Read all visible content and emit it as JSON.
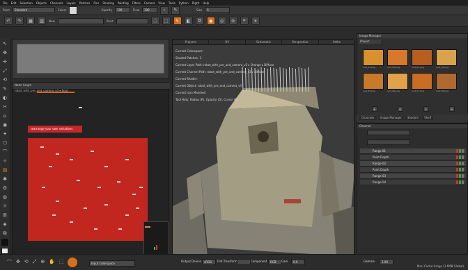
{
  "menu": [
    "File",
    "Edit",
    "Selection",
    "Objects",
    "Channels",
    "Layers",
    "Patches",
    "Pins",
    "Shading",
    "Painting",
    "Filters",
    "Camera",
    "View",
    "Tools",
    "Python",
    "Right",
    "Help"
  ],
  "toolbar1": {
    "paint_label": "Paint",
    "paint_mode": "Standard",
    "colors_label": "Colors",
    "opacity_label": "Opacity",
    "opacity_value": "100",
    "flow_label": "Flow",
    "flow_value": "100",
    "size_label": "Size",
    "size_value": "5"
  },
  "toolbar2": {
    "new_label": "New",
    "paint_label": "Paint"
  },
  "left_tools": [
    "↖",
    "✥",
    "✛",
    "⤢",
    "⟲",
    "✎",
    "◐",
    "✂",
    "⌂",
    "◉",
    "✦",
    "⬡",
    "⌒",
    "✧",
    "▤",
    "✱",
    "⚙",
    "◍",
    "☼",
    "⊞",
    "◈",
    "⧉"
  ],
  "node_graph": {
    "tab_label": "Node Graph",
    "path": "robot_with_pre_and_camera_v3 ▾ Root",
    "button_label": "rearrange your own variations"
  },
  "viewport": {
    "tabs": [
      "Projects",
      "UV",
      "Schematic",
      "Perspective",
      "Ortho"
    ],
    "info": [
      "Current Colorspace:",
      "Shaded Patches: 1",
      "Current Layer Path: robot_with_pre_and_camera_v3 ▸ Orange ▸ Diffuse",
      "Current Channel Path: robot_with_pre_and_camera_v3 ▸ Diffuse",
      "Current Shader:",
      "Current Object: robot_with_pre_and_camera_v3",
      "Current Icon Manifest:",
      "Tool Help: Radius (R), Opacity (O), Cursor (S)"
    ]
  },
  "image_manager": {
    "title": "Image Manager",
    "tab": "Project",
    "thumbs": [
      "rust_01.png",
      "rust_02.png",
      "rust_03.png",
      "rust_04.png",
      "rust_05.png",
      "rust_06.png",
      "rust_07.png",
      "rust_08.png"
    ],
    "colors": [
      "#d9912f",
      "#d6792a",
      "#b85e21",
      "#d9a24c",
      "#c97a28",
      "#e0a24a",
      "#c96d25",
      "#b06a30"
    ]
  },
  "shelf_tabs": [
    "Channels",
    "Image Manager",
    "Shaders",
    "Shelf"
  ],
  "layers": {
    "header": "Channel",
    "rows": [
      {
        "label": "Range 01",
        "sub": false
      },
      {
        "label": "Paint Depth",
        "sub": true
      },
      {
        "label": "Range 02",
        "sub": false
      },
      {
        "label": "Paint Depth",
        "sub": true
      },
      {
        "label": "Range 03",
        "sub": false
      },
      {
        "label": "Range 04",
        "sub": true
      }
    ]
  },
  "bottom": {
    "color_label": "Input Colorspace",
    "device_label": "Output Device",
    "device_value": "sRGB",
    "transform_label": "Flat Transform",
    "component_label": "Component",
    "component_value": "RGB",
    "gain_label": "Gain",
    "gain_value": "0.0",
    "gamma_label": "Gamma",
    "gamma_value": "1.00",
    "status": "Mari Cache Usage (1.6MB Global)"
  },
  "colors": {
    "accent": "#d76f1f",
    "node_red": "#c2271f"
  }
}
